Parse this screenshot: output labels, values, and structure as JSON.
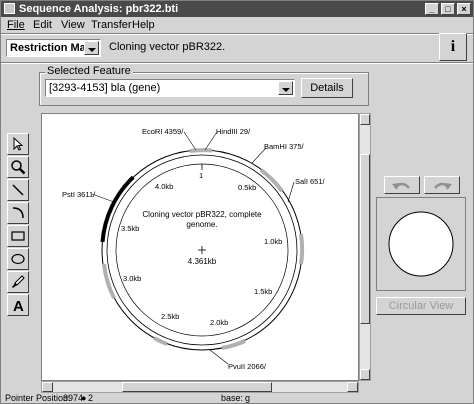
{
  "window": {
    "title": "Sequence Analysis: pbr322.bti",
    "buttons": [
      "_",
      "□",
      "×"
    ]
  },
  "menu": {
    "file": "File",
    "edit": "Edit",
    "view": "View",
    "transfer": "Transfer",
    "help": "Help"
  },
  "toolbar": {
    "view_mode": "Restriction Map",
    "description": "Cloning vector pBR322.",
    "info_icon": "i"
  },
  "selected_feature": {
    "group_label": "Selected Feature",
    "value": "[3293-4153] bla (gene)",
    "details_button": "Details"
  },
  "map": {
    "center_text_line1": "Cloning vector pBR322, complete",
    "center_text_line2": "genome.",
    "length": "4.361kb",
    "tick_top": "1",
    "scale_labels": [
      "0.5kb",
      "1.0kb",
      "1.5kb",
      "2.0kb",
      "2.5kb",
      "3.0kb",
      "3.5kb",
      "4.0kb"
    ],
    "sites": [
      "EcoRI 4359/",
      "HindIII 29/",
      "BamHI 375/",
      "SalI 651/",
      "PvuII 2066/",
      "PstI 3611/"
    ]
  },
  "side_panel": {
    "circular_view_button": "Circular View"
  },
  "status": {
    "pointer_label": "Pointer Position:",
    "pointer_value": "3974",
    "pointer_suffix": "2",
    "base_label": "base:",
    "base_value": "g"
  }
}
